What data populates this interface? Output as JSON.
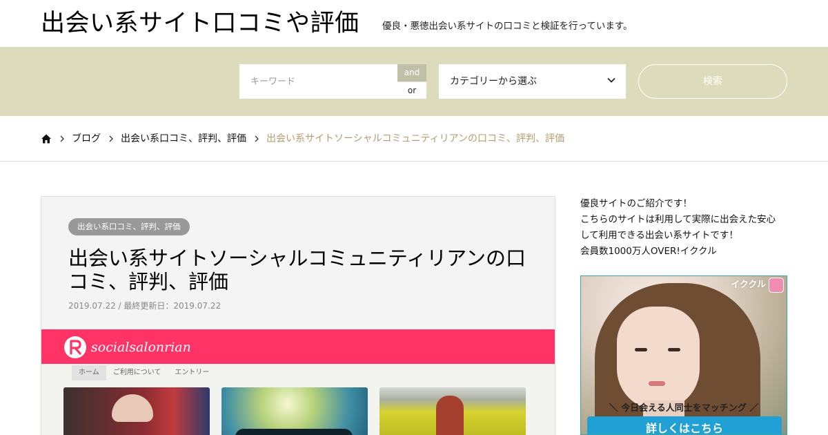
{
  "header": {
    "site_title": "出会い系サイト口コミや評価",
    "site_description": "優良・悪徳出会い系サイトの口コミと検証を行っています。"
  },
  "search": {
    "keyword_placeholder": "キーワード",
    "keyword_value": "",
    "and_label": "and",
    "or_label": "or",
    "selected_operator": "and",
    "category_selected": "カテゴリーから選ぶ",
    "search_button": "検索"
  },
  "breadcrumb": {
    "home_icon": "home-icon",
    "items": [
      "ブログ",
      "出会い系口コミ、評判、評価"
    ],
    "current": "出会い系サイトソーシャルコミュニティリアンの口コミ、評判、評価"
  },
  "article": {
    "category": "出会い系口コミ、評判、評価",
    "title": "出会い系サイトソーシャルコミュニティリアンの口コミ、評判、評価",
    "date_text": "2019.07.22 / 最終更新日：2019.07.22",
    "thumbnail": {
      "logo_text": "socialsalonrian",
      "nav_items": [
        "ホーム",
        "ご利用について",
        "エントリー"
      ],
      "brand_color": "#ff3366"
    }
  },
  "sidebar": {
    "intro_lines": [
      "優良サイトのご紹介です！",
      "こちらのサイトは利用して実際に出会えた安心",
      "して利用できる出会い系サイトです！",
      "会員数1000万人OVER!イククル"
    ],
    "ad": {
      "brand": "イククル",
      "caption": "＼ 今日会える人同士をマッチング ／",
      "button": "詳しくはこちら",
      "button_color": "#20a0d4"
    }
  },
  "colors": {
    "search_band": "#dcdcbc",
    "breadcrumb_current": "#b59c6e",
    "category_badge": "#999999"
  }
}
